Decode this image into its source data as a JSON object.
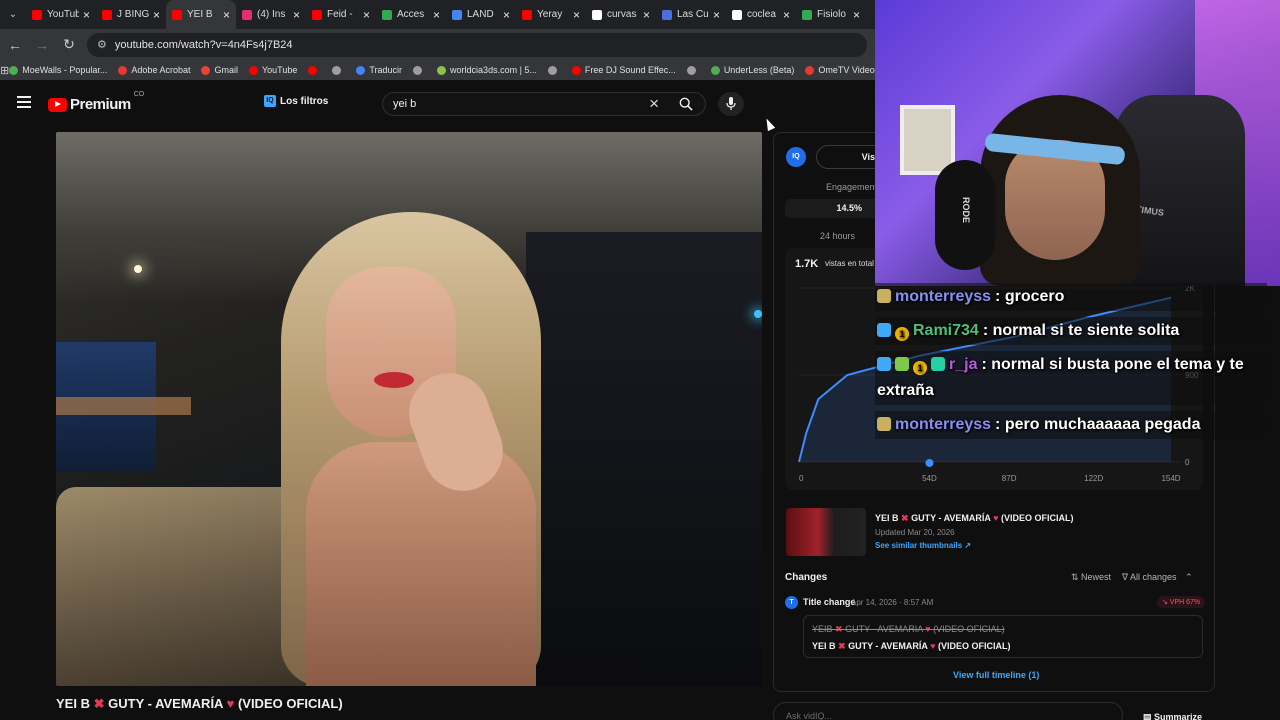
{
  "browser": {
    "tabs": [
      {
        "title": "YouTube",
        "favicon_color": "#ff0000"
      },
      {
        "title": "J BING",
        "favicon_color": "#ff0000"
      },
      {
        "title": "YEI B",
        "favicon_color": "#ff0000",
        "active": true
      },
      {
        "title": "(4) Ins",
        "favicon_color": "#e1306c"
      },
      {
        "title": "Feid -",
        "favicon_color": "#ff0000"
      },
      {
        "title": "Acces",
        "favicon_color": "#34a853"
      },
      {
        "title": "LAND",
        "favicon_color": "#4285f4"
      },
      {
        "title": "Yeray",
        "favicon_color": "#ff0000"
      },
      {
        "title": "curvas",
        "favicon_color": "#ffffff"
      },
      {
        "title": "Las Cu",
        "favicon_color": "#4a6fe0"
      },
      {
        "title": "coclea",
        "favicon_color": "#ffffff"
      },
      {
        "title": "Fisiolo",
        "favicon_color": "#34a853"
      }
    ],
    "url": "youtube.com/watch?v=4n4Fs4j7B24",
    "bookmarks": [
      {
        "label": "MoeWalls - Popular...",
        "color": "#4caf50"
      },
      {
        "label": "Adobe Acrobat",
        "color": "#e53935"
      },
      {
        "label": "Gmail",
        "color": "#ea4335"
      },
      {
        "label": "YouTube",
        "color": "#ff0000"
      },
      {
        "label": "",
        "color": "#ff0000"
      },
      {
        "label": "",
        "color": "#9e9e9e"
      },
      {
        "label": "Traducir",
        "color": "#4285f4"
      },
      {
        "label": "",
        "color": "#9e9e9e"
      },
      {
        "label": "worldcia3ds.com | 5...",
        "color": "#8bc34a"
      },
      {
        "label": "",
        "color": "#9e9e9e"
      },
      {
        "label": "Free DJ Sound Effec...",
        "color": "#ff0000"
      },
      {
        "label": "",
        "color": "#9e9e9e"
      },
      {
        "label": "UnderLess (Beta)",
        "color": "#4caf50"
      },
      {
        "label": "OmeTV Video Chat...",
        "color": "#e53935"
      }
    ]
  },
  "youtube": {
    "logo": "Premium",
    "country": "CO",
    "filters_label": "Los filtros",
    "search_value": "yei b",
    "video_title_a": "YEI B",
    "video_title_b": "GUTY - AVEMARÍA",
    "video_title_c": "(VIDEO OFICIAL)"
  },
  "vidiq": {
    "badge": "IQ",
    "views_tab": "Vis",
    "engagement_label": "Engagement",
    "engagement_value": "14.5%",
    "period": "24 hours",
    "total_views": "1.7K",
    "total_views_label": "vistas en total",
    "video_card": {
      "name_a": "YEI B",
      "name_b": "GUTY - AVEMARÍA",
      "name_c": "(VIDEO OFICIAL)",
      "updated": "Updated Mar 20, 2026",
      "similar": "See similar thumbnails ↗"
    },
    "changes": {
      "heading": "Changes",
      "sort": "⇅ Newest",
      "filter": "∇ All changes",
      "item_label": "Title change",
      "item_date": "Apr 14, 2026 · 8:57 AM",
      "vph": "↘ VPH 67%",
      "old_a": "YEIB",
      "old_b": "GUTY - AVEMARIA",
      "old_c": "(VIDEO OFICIAL)",
      "new_a": "YEI B",
      "new_b": "GUTY - AVEMARÍA",
      "new_c": "(VIDEO OFICIAL)",
      "timeline": "View full timeline (1)"
    },
    "ask_placeholder": "Ask vidIQ...",
    "summarize": "Summarize"
  },
  "chart_data": {
    "type": "line",
    "x_ticks": [
      "0",
      "54D",
      "87D",
      "122D",
      "154D"
    ],
    "y_ticks": [
      "0",
      "900"
    ],
    "y_top_tick": "2K",
    "ylim": [
      0,
      1800
    ],
    "points": [
      [
        0,
        0
      ],
      [
        3,
        300
      ],
      [
        8,
        650
      ],
      [
        20,
        900
      ],
      [
        50,
        1100
      ],
      [
        90,
        1300
      ],
      [
        120,
        1500
      ],
      [
        154,
        1700
      ]
    ]
  },
  "stream": {
    "chair_brand": "OPTIMUS",
    "mic_brand": "RODE",
    "chat": [
      {
        "badges": [
          "clap"
        ],
        "user": "monterreyss",
        "msg": ": grocero"
      },
      {
        "badges": [
          "cube",
          "num"
        ],
        "user": "Rami734",
        "msg": ": normal si te siente solita"
      },
      {
        "badges": [
          "cube",
          "mic",
          "num",
          "grid"
        ],
        "user": "r_ja",
        "msg": ": normal si busta pone el tema y te extraña"
      },
      {
        "badges": [
          "clap"
        ],
        "user": "monterreyss",
        "msg": ": pero muchaaaaaa pegada"
      }
    ]
  }
}
